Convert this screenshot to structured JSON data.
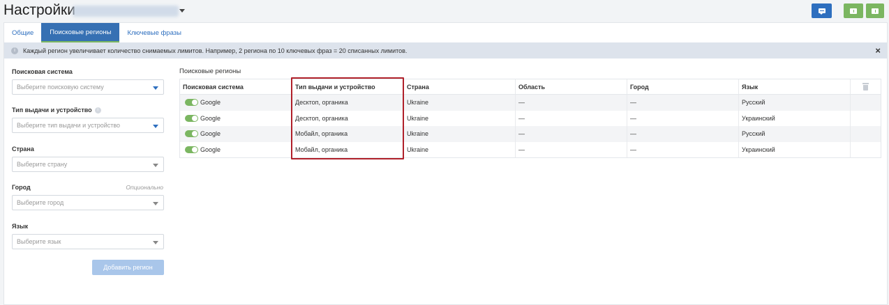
{
  "header": {
    "title": "Настройки",
    "buttons": [
      {
        "icon": "chat-icon",
        "color": "#2e6fbf"
      },
      {
        "icon": "feedback-icon",
        "color": "#7bb661"
      },
      {
        "icon": "download-icon",
        "color": "#7bb661"
      }
    ]
  },
  "tabs": [
    {
      "label": "Общие",
      "active": false
    },
    {
      "label": "Поисковые регионы",
      "active": true
    },
    {
      "label": "Ключевые фразы",
      "active": false
    }
  ],
  "info": {
    "text": "Каждый регион увеличивает количество снимаемых лимитов. Например, 2 региона по 10 ключевых фраз = 20 списанных лимитов.",
    "close": "×"
  },
  "form": {
    "search_engine": {
      "label": "Поисковая система",
      "placeholder": "Выберите поисковую систему"
    },
    "serp_type": {
      "label": "Тип выдачи и устройство",
      "placeholder": "Выберите тип выдачи и устройство"
    },
    "country": {
      "label": "Страна",
      "placeholder": "Выберите страну"
    },
    "city": {
      "label": "Город",
      "optional": "Опционально",
      "placeholder": "Выберите город"
    },
    "language": {
      "label": "Язык",
      "placeholder": "Выберите язык"
    },
    "add_button": "Добавить регион"
  },
  "regions": {
    "title": "Поисковые регионы",
    "columns": [
      "Поисковая система",
      "Тип выдачи и устройство",
      "Страна",
      "Область",
      "Город",
      "Язык"
    ],
    "rows": [
      {
        "engine": "Google",
        "type": "Десктоп, органика",
        "country": "Ukraine",
        "region": "—",
        "city": "—",
        "language": "Русский",
        "enabled": true
      },
      {
        "engine": "Google",
        "type": "Десктоп, органика",
        "country": "Ukraine",
        "region": "—",
        "city": "—",
        "language": "Украинский",
        "enabled": true
      },
      {
        "engine": "Google",
        "type": "Мобайл, органика",
        "country": "Ukraine",
        "region": "—",
        "city": "—",
        "language": "Русский",
        "enabled": true
      },
      {
        "engine": "Google",
        "type": "Мобайл, органика",
        "country": "Ukraine",
        "region": "—",
        "city": "—",
        "language": "Украинский",
        "enabled": true
      }
    ]
  },
  "colors": {
    "primary": "#2e6fbf",
    "accent_green": "#7bb661",
    "highlight": "#b0202a"
  }
}
